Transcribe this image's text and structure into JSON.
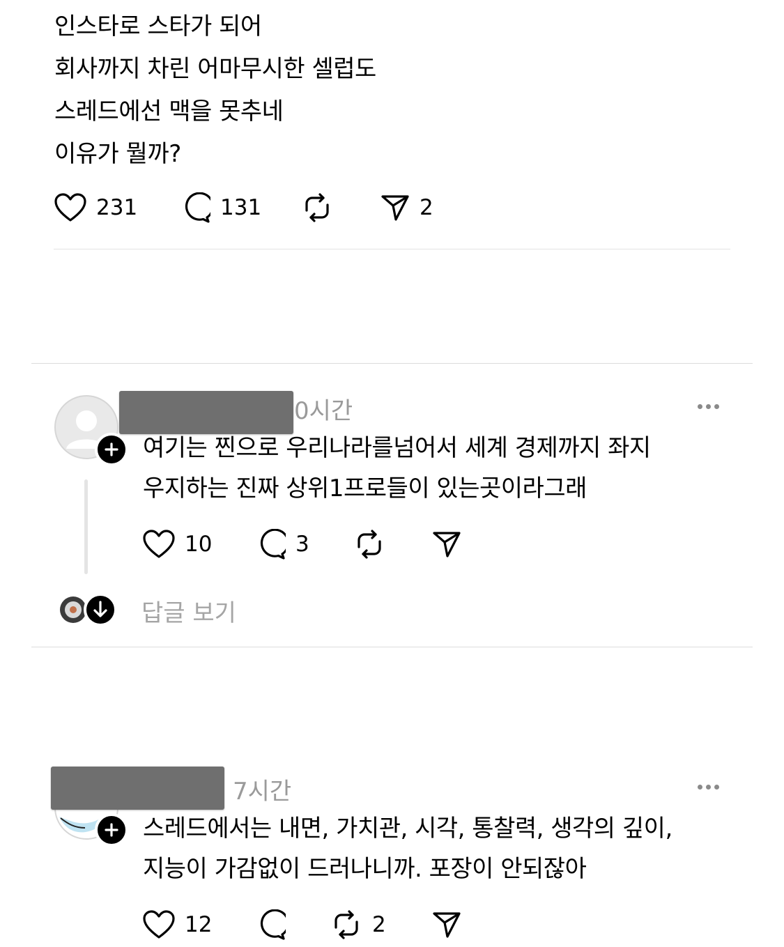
{
  "post": {
    "text": "인스타로 스타가 되어\n회사까지 차린 어마무시한 셀럽도\n스레드에선 맥을 못추네\n이유가 뭘까?",
    "likes": "231",
    "comments": "131",
    "shares": "2"
  },
  "replies": [
    {
      "time": "0시간",
      "text": "여기는 찐으로 우리나라를넘어서 세계 경제까지 좌지\n우지하는 진짜 상위1프로들이 있는곳이라그래",
      "likes": "10",
      "comments": "3",
      "view_replies_label": "답글 보기"
    },
    {
      "time": "7시간",
      "text": "스레드에서는 내면, 가치관, 시각, 통찰력, 생각의 깊이,\n지능이 가감없이 드러나니까. 포장이 안되잖아",
      "likes": "12",
      "reposts": "2"
    }
  ],
  "icons": {
    "like": "heart-icon",
    "comment": "comment-bubble-icon",
    "repost": "repost-icon",
    "share": "send-icon",
    "more": "more-dots-icon",
    "follow": "plus-icon",
    "expand": "arrow-down-icon"
  },
  "colors": {
    "text": "#000000",
    "muted": "#9a9a9a",
    "redaction": "#6f6f6f",
    "divider": "#dcdcdc"
  }
}
